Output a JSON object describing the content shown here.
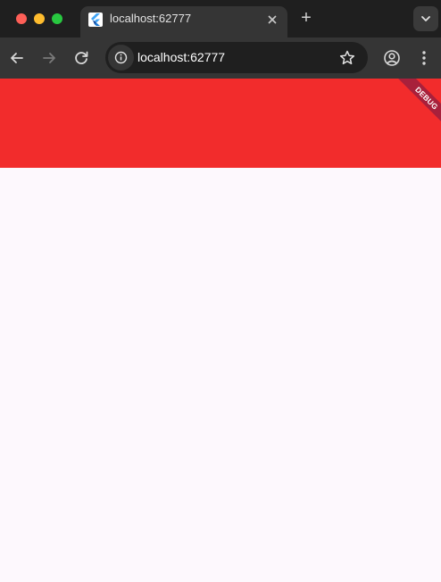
{
  "browser": {
    "tab": {
      "title": "localhost:62777",
      "close_icon": "close-icon",
      "favicon": "flutter-logo"
    },
    "new_tab_label": "+",
    "address_bar": {
      "url": "localhost:62777"
    }
  },
  "app": {
    "debug_banner": "DEBUG",
    "appbar_color": "#f22c2c",
    "background_color": "#fdf8fd"
  }
}
